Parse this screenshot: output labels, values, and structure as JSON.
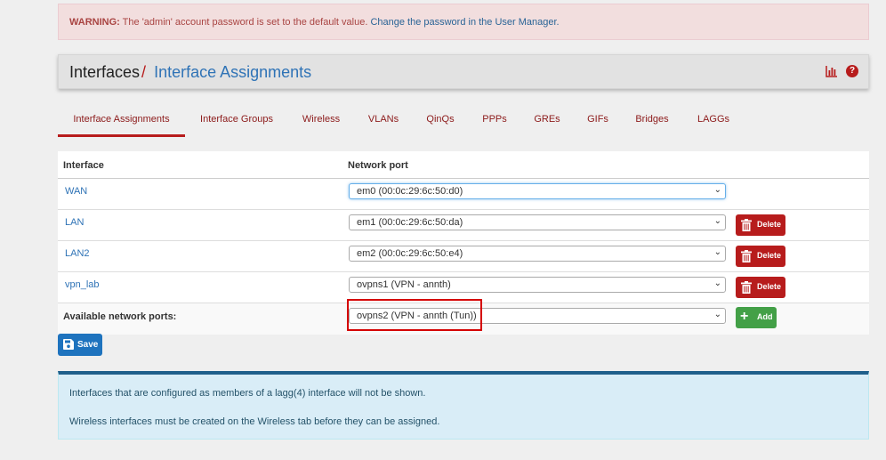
{
  "warning": {
    "prefix": "WARNING:",
    "text": " The 'admin' account password is set to the default value. ",
    "link": "Change the password in the User Manager."
  },
  "header": {
    "title": "Interfaces",
    "separator": "/",
    "subtitle": "Interface Assignments",
    "icons": [
      "bar-chart-icon",
      "help-icon"
    ]
  },
  "tabs": [
    {
      "label": "Interface Assignments",
      "active": true
    },
    {
      "label": "Interface Groups"
    },
    {
      "label": "Wireless"
    },
    {
      "label": "VLANs"
    },
    {
      "label": "QinQs"
    },
    {
      "label": "PPPs"
    },
    {
      "label": "GREs"
    },
    {
      "label": "GIFs"
    },
    {
      "label": "Bridges"
    },
    {
      "label": "LAGGs"
    }
  ],
  "table": {
    "col_interface": "Interface",
    "col_network_port": "Network port",
    "rows": [
      {
        "interface": "WAN",
        "port": "em0 (00:0c:29:6c:50:d0)"
      },
      {
        "interface": "LAN",
        "port": "em1 (00:0c:29:6c:50:da)",
        "delete": "Delete"
      },
      {
        "interface": "LAN2",
        "port": "em2 (00:0c:29:6c:50:e4)",
        "delete": "Delete"
      },
      {
        "interface": "vpn_lab",
        "port": "ovpns1 (VPN - annth)",
        "delete": "Delete"
      }
    ],
    "available_label": "Available network ports:",
    "available_value": "ovpns2 (VPN - annth (Tun))",
    "add_label": "Add"
  },
  "save_label": "Save",
  "info": {
    "line1": "Interfaces that are configured as members of a lagg(4) interface will not be shown.",
    "line2": "Wireless interfaces must be created on the Wireless tab before they can be assigned."
  },
  "colors": {
    "danger": "#b71c1c",
    "success": "#43a047",
    "primary": "#1e73be",
    "link": "#2f73b6"
  }
}
